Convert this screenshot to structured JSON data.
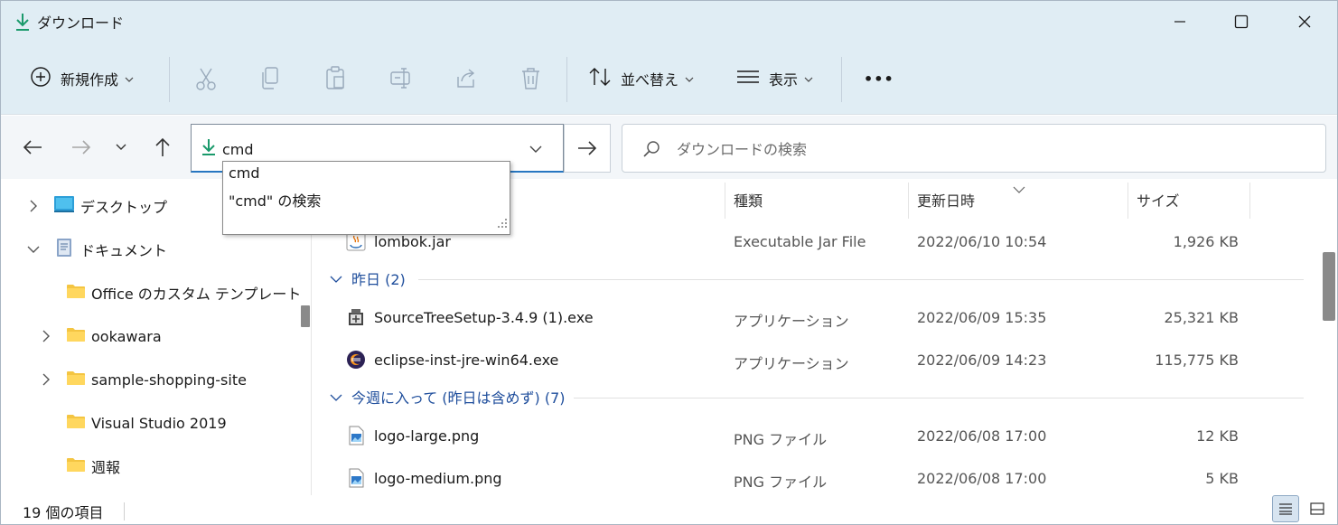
{
  "window": {
    "title": "ダウンロード"
  },
  "toolbar": {
    "new_label": "新規作成",
    "sort_label": "並べ替え",
    "view_label": "表示",
    "more_label": "•••"
  },
  "address": {
    "value": "cmd"
  },
  "search": {
    "placeholder": "ダウンロードの検索"
  },
  "suggestions": [
    "cmd",
    "\"cmd\" の検索"
  ],
  "sidebar": {
    "items": [
      {
        "label": "デスクトップ",
        "icon": "desktop-icon",
        "chevron": "right"
      },
      {
        "label": "ドキュメント",
        "icon": "documents-icon",
        "chevron": "down"
      },
      {
        "label": "Office のカスタム テンプレート",
        "icon": "folder-icon",
        "chevron": "none"
      },
      {
        "label": "ookawara",
        "icon": "folder-icon",
        "chevron": "right"
      },
      {
        "label": "sample-shopping-site",
        "icon": "folder-icon",
        "chevron": "right"
      },
      {
        "label": "Visual Studio 2019",
        "icon": "folder-icon",
        "chevron": "none"
      },
      {
        "label": "週報",
        "icon": "folder-icon",
        "chevron": "none"
      }
    ]
  },
  "columns": {
    "type": "種類",
    "date": "更新日時",
    "size": "サイズ"
  },
  "groups": {
    "yesterday": "昨日 (2)",
    "this_week": "今週に入って (昨日は含めず) (7)"
  },
  "files": [
    {
      "name": "lombok.jar",
      "type": "Executable Jar File",
      "date": "2022/06/10 10:54",
      "size": "1,926 KB",
      "icon": "jar-icon"
    },
    {
      "name": "SourceTreeSetup-3.4.9 (1).exe",
      "type": "アプリケーション",
      "date": "2022/06/09 15:35",
      "size": "25,321 KB",
      "icon": "installer-icon"
    },
    {
      "name": "eclipse-inst-jre-win64.exe",
      "type": "アプリケーション",
      "date": "2022/06/09 14:23",
      "size": "115,775 KB",
      "icon": "eclipse-icon"
    },
    {
      "name": "logo-large.png",
      "type": "PNG ファイル",
      "date": "2022/06/08 17:00",
      "size": "12 KB",
      "icon": "png-file-icon"
    },
    {
      "name": "logo-medium.png",
      "type": "PNG ファイル",
      "date": "2022/06/08 17:00",
      "size": "5 KB",
      "icon": "png-file-icon"
    }
  ],
  "status": {
    "item_count": "19 個の項目"
  },
  "colors": {
    "accent": "#2676c1",
    "download_green": "#1a9a6b",
    "group_blue": "#1f4e9c",
    "folder": "#f4c542"
  }
}
